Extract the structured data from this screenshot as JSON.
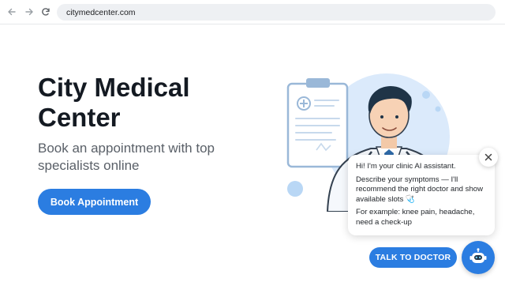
{
  "browser": {
    "url": "citymedcenter.com",
    "icons": [
      "back-arrow-icon",
      "forward-arrow-icon",
      "reload-icon"
    ]
  },
  "hero": {
    "title_line1": "City Medical",
    "title_line2": "Center",
    "subtitle_line1": "Book an appointment with top",
    "subtitle_line2": "specialists online",
    "button_label": "Book Appointment"
  },
  "chat": {
    "greeting": "Hi! I'm your clinic AI assistant.",
    "message": "Describe your symptoms — I'll recommend the right doctor and show available slots 🩺",
    "example": "For example: knee pain, headache, need a check-up",
    "talk_button": "TALK TO DOCTOR",
    "icons": [
      "close-icon",
      "robot-icon"
    ]
  },
  "colors": {
    "accent": "#2b7de1",
    "title": "#141a22",
    "subtitle": "#5a6068",
    "illustration_bg": "#dbeafb"
  }
}
